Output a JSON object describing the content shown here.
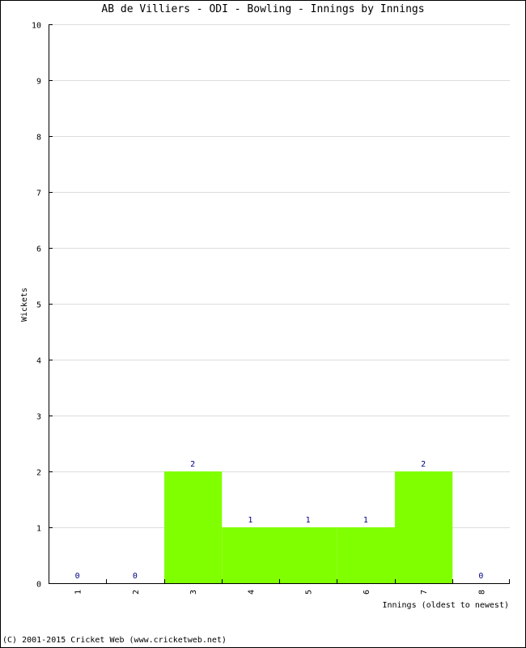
{
  "chart_data": {
    "type": "bar",
    "title": "AB de Villiers - ODI - Bowling - Innings by Innings",
    "xlabel": "Innings (oldest to newest)",
    "ylabel": "Wickets",
    "categories": [
      "1",
      "2",
      "3",
      "4",
      "5",
      "6",
      "7",
      "8"
    ],
    "values": [
      0,
      0,
      2,
      1,
      1,
      1,
      2,
      0
    ],
    "ylim": [
      0,
      10
    ],
    "yticks": [
      0,
      1,
      2,
      3,
      4,
      5,
      6,
      7,
      8,
      9,
      10
    ],
    "grid": true,
    "bar_color": "#80ff00",
    "label_color": "#000080",
    "grid_color": "#dddddd"
  },
  "footer": "(C) 2001-2015 Cricket Web (www.cricketweb.net)"
}
